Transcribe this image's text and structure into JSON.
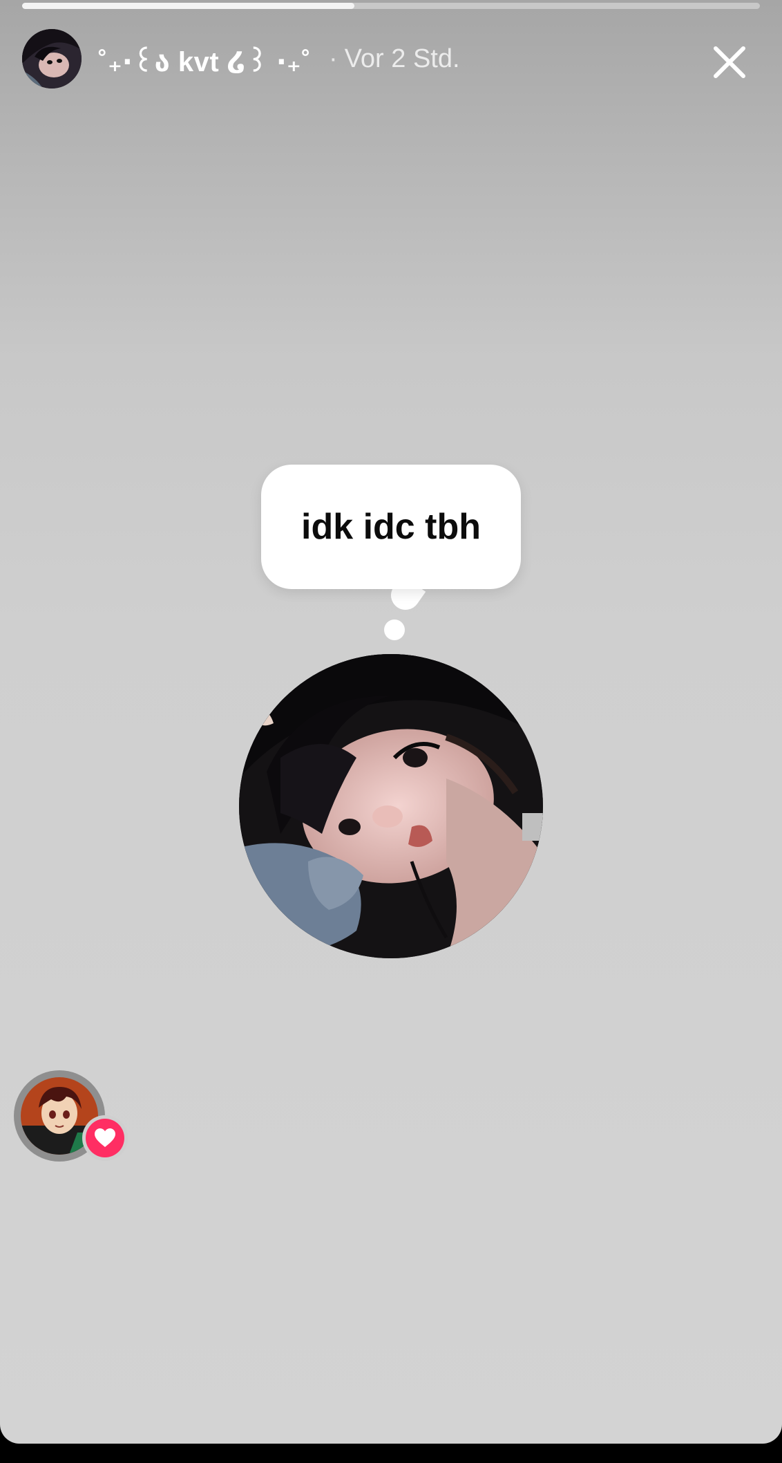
{
  "story": {
    "progress_fraction": 0.45,
    "author_name": "˚₊‧꒰ა kvt ໒꒱ ‧₊˚",
    "separator": "·",
    "timestamp": "Vor 2 Std."
  },
  "note": {
    "text": "idk idc tbh"
  },
  "icons": {
    "close": "close-icon",
    "heart": "heart-icon"
  },
  "colors": {
    "heart_badge": "#ff2e63",
    "note_background": "#ffffff",
    "background": "#d0d0d0"
  }
}
